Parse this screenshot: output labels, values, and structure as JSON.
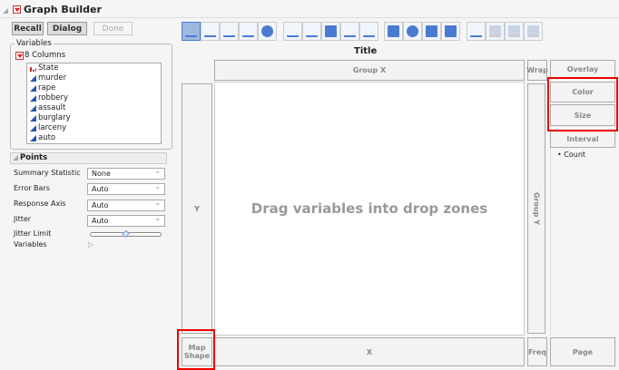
{
  "window": {
    "title": "Graph Builder"
  },
  "buttons": {
    "recall": "Recall",
    "dialog": "Dialog",
    "done": "Done"
  },
  "variables": {
    "label": "Variables",
    "columns_label": "8 Columns",
    "items": [
      {
        "name": "State",
        "type": "nominal"
      },
      {
        "name": "murder",
        "type": "continuous"
      },
      {
        "name": "rape",
        "type": "continuous"
      },
      {
        "name": "robbery",
        "type": "continuous"
      },
      {
        "name": "assault",
        "type": "continuous"
      },
      {
        "name": "burglary",
        "type": "continuous"
      },
      {
        "name": "larceny",
        "type": "continuous"
      },
      {
        "name": "auto",
        "type": "continuous"
      }
    ]
  },
  "points": {
    "title": "Points",
    "summary_statistic": {
      "label": "Summary Statistic",
      "value": "None"
    },
    "error_bars": {
      "label": "Error Bars",
      "value": "Auto"
    },
    "response_axis": {
      "label": "Response Axis",
      "value": "Auto"
    },
    "jitter": {
      "label": "Jitter",
      "value": "Auto"
    },
    "jitter_limit": {
      "label": "Jitter Limit",
      "value_fraction": 0.5
    },
    "variables": {
      "label": "Variables"
    }
  },
  "toolbar": {
    "icons": [
      "points",
      "smoother",
      "line-of-fit",
      "ellipse",
      "contour",
      "line",
      "bar",
      "area",
      "box-plot",
      "histogram",
      "heatmap",
      "pie",
      "treemap",
      "mosaic",
      "caption-box",
      "formula",
      "map-shapes",
      "parallel"
    ],
    "selected": "points",
    "accent": "#4a7bd0"
  },
  "graph": {
    "title": "Title",
    "placeholder": "Drag variables into drop zones",
    "zones": {
      "group_x": "Group X",
      "wrap": "Wrap",
      "overlay": "Overlay",
      "color": "Color",
      "size": "Size",
      "interval": "Interval",
      "y": "Y",
      "group_y": "Group Y",
      "map_shape": "Map Shape",
      "x": "X",
      "freq": "Freq",
      "page": "Page"
    },
    "interval_option": "Count"
  },
  "highlight_color": "#e00000"
}
